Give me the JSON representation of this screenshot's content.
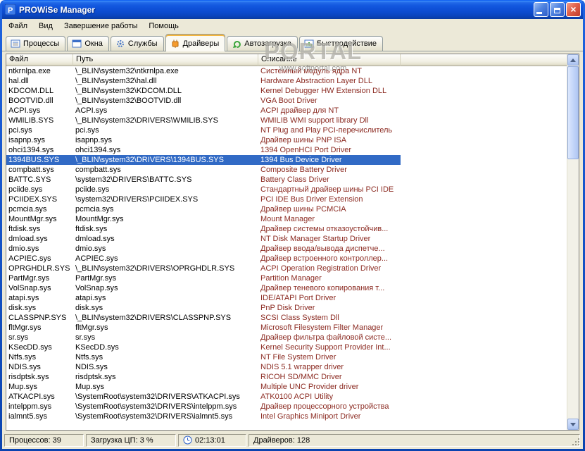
{
  "window": {
    "title": "PROWiSe Manager"
  },
  "colors": {
    "selection": "#316AC5",
    "description-text": "#8B2A21",
    "titlebar": "#0F58D8",
    "chrome": "#ECE9D8"
  },
  "icons": {
    "close-icon": "×",
    "minimize-icon": "minimize",
    "maximize-icon": "maximize",
    "app-icon": "P",
    "clock-icon": "clock"
  },
  "menu": {
    "items": [
      "Файл",
      "Вид",
      "Завершение работы",
      "Помощь"
    ]
  },
  "tabs": [
    {
      "label": "Процессы",
      "icon": "processes-icon",
      "active": false
    },
    {
      "label": "Окна",
      "icon": "windows-icon",
      "active": false
    },
    {
      "label": "Службы",
      "icon": "services-icon",
      "active": false
    },
    {
      "label": "Драйверы",
      "icon": "drivers-icon",
      "active": true
    },
    {
      "label": "Автозагрузка",
      "icon": "startup-icon",
      "active": false
    },
    {
      "label": "Быстродействие",
      "icon": "performance-icon",
      "active": false
    }
  ],
  "watermark": {
    "big": "PORTAL",
    "small": "www.softportal.com"
  },
  "table": {
    "columns": [
      "Файл",
      "Путь",
      "Описание"
    ],
    "selected_index": 9,
    "rows": [
      [
        "ntkrnlpa.exe",
        "\\_BLIN\\system32\\ntkrnlpa.exe",
        "Системный модуль ядра NT"
      ],
      [
        "hal.dll",
        "\\_BLIN\\system32\\hal.dll",
        "Hardware Abstraction Layer DLL"
      ],
      [
        "KDCOM.DLL",
        "\\_BLIN\\system32\\KDCOM.DLL",
        "Kernel Debugger HW Extension DLL"
      ],
      [
        "BOOTVID.dll",
        "\\_BLIN\\system32\\BOOTVID.dll",
        "VGA Boot Driver"
      ],
      [
        "ACPI.sys",
        "ACPI.sys",
        "ACPI драйвер для NT"
      ],
      [
        "WMILIB.SYS",
        "\\_BLIN\\system32\\DRIVERS\\WMILIB.SYS",
        "WMILIB WMI support library Dll"
      ],
      [
        "pci.sys",
        "pci.sys",
        "NT Plug and Play PCI-перечислитель"
      ],
      [
        "isapnp.sys",
        "isapnp.sys",
        "Драйвер шины PNP ISA"
      ],
      [
        "ohci1394.sys",
        "ohci1394.sys",
        "1394 OpenHCI Port Driver"
      ],
      [
        "1394BUS.SYS",
        "\\_BLIN\\system32\\DRIVERS\\1394BUS.SYS",
        "1394 Bus Device Driver"
      ],
      [
        "compbatt.sys",
        "compbatt.sys",
        "Composite Battery Driver"
      ],
      [
        "BATTC.SYS",
        "\\system32\\DRIVERS\\BATTC.SYS",
        "Battery Class Driver"
      ],
      [
        "pciide.sys",
        "pciide.sys",
        "Стандартный драйвер шины PCI IDE"
      ],
      [
        "PCIIDEX.SYS",
        "\\system32\\DRIVERS\\PCIIDEX.SYS",
        "PCI IDE Bus Driver Extension"
      ],
      [
        "pcmcia.sys",
        "pcmcia.sys",
        "Драйвер шины PCMCIA"
      ],
      [
        "MountMgr.sys",
        "MountMgr.sys",
        "Mount Manager"
      ],
      [
        "ftdisk.sys",
        "ftdisk.sys",
        "Драйвер системы отказоустойчив..."
      ],
      [
        "dmload.sys",
        "dmload.sys",
        "NT Disk Manager Startup Driver"
      ],
      [
        "dmio.sys",
        "dmio.sys",
        "Драйвер ввода/вывода диспетче..."
      ],
      [
        "ACPIEC.sys",
        "ACPIEC.sys",
        "Драйвер встроенного контроллер..."
      ],
      [
        "OPRGHDLR.SYS",
        "\\_BLIN\\system32\\DRIVERS\\OPRGHDLR.SYS",
        "ACPI Operation Registration Driver"
      ],
      [
        "PartMgr.sys",
        "PartMgr.sys",
        "Partition Manager"
      ],
      [
        "VolSnap.sys",
        "VolSnap.sys",
        "Драйвер теневого копирования т..."
      ],
      [
        "atapi.sys",
        "atapi.sys",
        "IDE/ATAPI Port Driver"
      ],
      [
        "disk.sys",
        "disk.sys",
        "PnP Disk Driver"
      ],
      [
        "CLASSPNP.SYS",
        "\\_BLIN\\system32\\DRIVERS\\CLASSPNP.SYS",
        "SCSI Class System Dll"
      ],
      [
        "fltMgr.sys",
        "fltMgr.sys",
        "Microsoft Filesystem Filter Manager"
      ],
      [
        "sr.sys",
        "sr.sys",
        "Драйвер фильтра файловой систе..."
      ],
      [
        "KSecDD.sys",
        "KSecDD.sys",
        "Kernel Security Support Provider Int..."
      ],
      [
        "Ntfs.sys",
        "Ntfs.sys",
        "NT File System Driver"
      ],
      [
        "NDIS.sys",
        "NDIS.sys",
        "NDIS 5.1 wrapper driver"
      ],
      [
        "risdptsk.sys",
        "risdptsk.sys",
        "RICOH SD/MMC Driver"
      ],
      [
        "Mup.sys",
        "Mup.sys",
        "Multiple UNC Provider driver"
      ],
      [
        "ATKACPI.sys",
        "\\SystemRoot\\system32\\DRIVERS\\ATKACPI.sys",
        "ATK0100 ACPI Utility"
      ],
      [
        "intelppm.sys",
        "\\SystemRoot\\system32\\DRIVERS\\intelppm.sys",
        "Драйвер процессорного устройства"
      ],
      [
        "ialmnt5.sys",
        "\\SystemRoot\\system32\\DRIVERS\\ialmnt5.sys",
        "Intel Graphics Miniport Driver"
      ]
    ]
  },
  "statusbar": {
    "processes": "Процессов: 39",
    "cpu": "Загрузка ЦП:  3 %",
    "time": "02:13:01",
    "drivers": "Драйверов: 128"
  }
}
